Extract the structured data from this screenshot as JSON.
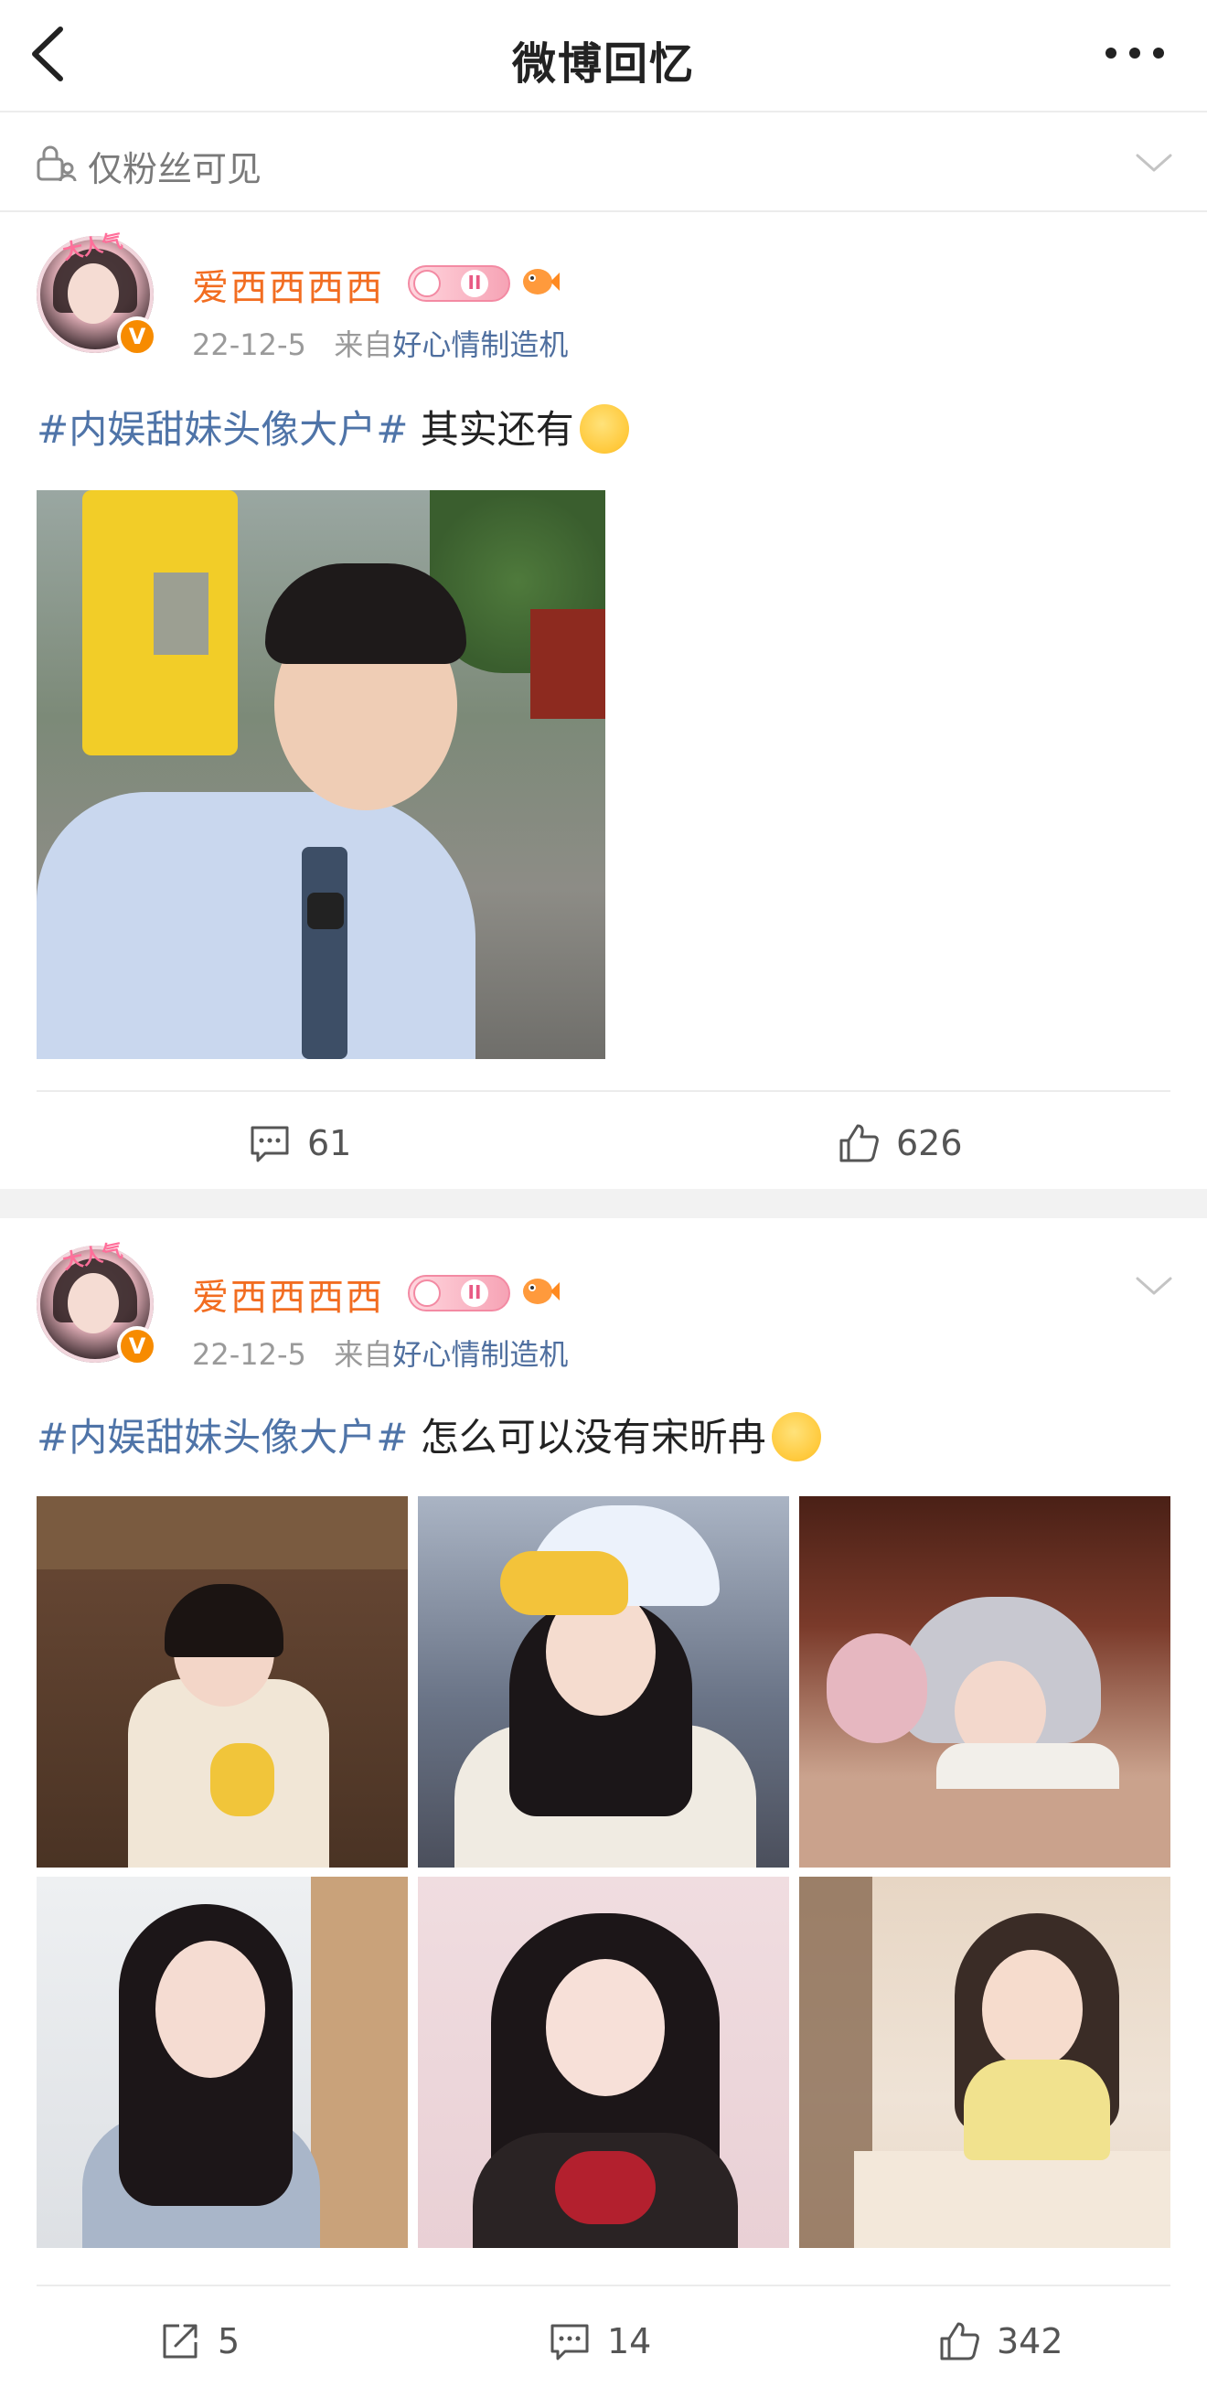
{
  "nav": {
    "title": "微博回忆",
    "back_icon": "chevron-left-icon",
    "more_icon": "more-dots-icon"
  },
  "privacy": {
    "label": "仅粉丝可见",
    "icon": "lock-person-icon"
  },
  "posts": [
    {
      "username": "爱西西西西",
      "avatar_tag": "大人气",
      "level": "II",
      "date": "22-12-5",
      "from_prefix": "来自",
      "source": "好心情制造机",
      "hashtag": "#内娱甜妹头像大户#",
      "text": " 其实还有",
      "emoji": "shush-emoji",
      "comments": "61",
      "likes": "626"
    },
    {
      "username": "爱西西西西",
      "avatar_tag": "大人气",
      "level": "II",
      "date": "22-12-5",
      "from_prefix": "来自",
      "source": "好心情制造机",
      "hashtag": "#内娱甜妹头像大户#",
      "text": " 怎么可以没有宋昕冉",
      "emoji": "smiling-hearts-emoji",
      "reposts": "5",
      "comments": "14",
      "likes": "342"
    }
  ],
  "colors": {
    "username": "#f26d21",
    "link": "#4f74a8",
    "meta": "#9a9a9a"
  }
}
